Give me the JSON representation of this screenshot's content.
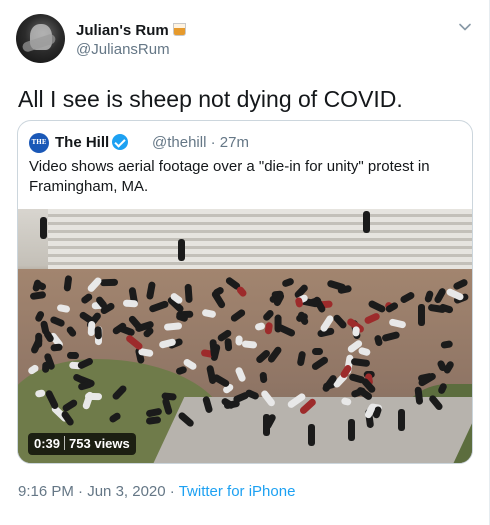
{
  "author": {
    "name": "Julian's Rum",
    "name_emoji": "tumbler-glass-icon",
    "handle": "@JuliansRum"
  },
  "tweet": {
    "text": "All I see is sheep not dying of COVID."
  },
  "quoted": {
    "logo_text": "THE HILL",
    "name": "The Hill",
    "handle": "@thehill",
    "dot": "·",
    "time": "27m",
    "text": "Video shows aerial footage over a \"die-in for unity\" protest in Framingham, MA.",
    "video": {
      "duration": "0:39",
      "views": "753 views"
    }
  },
  "footer": {
    "time": "9:16 PM",
    "sep1": "·",
    "date": "Jun 3, 2020",
    "sep2": "·",
    "source": "Twitter for iPhone"
  },
  "colors": {
    "text": "#14171a",
    "secondary": "#657786",
    "link": "#1da1f2",
    "border": "#ccd6dd"
  },
  "icons": [
    "chevron-down-icon",
    "verified-badge-icon",
    "tumbler-glass-icon"
  ]
}
